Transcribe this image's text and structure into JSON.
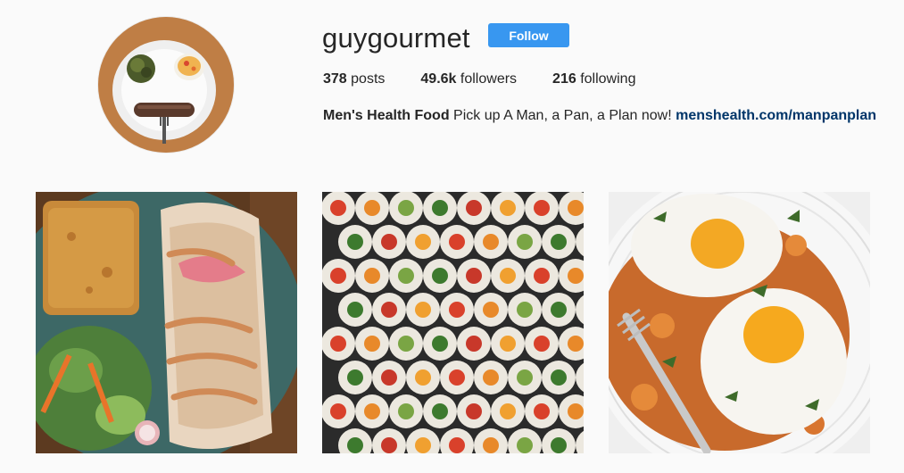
{
  "profile": {
    "username": "guygourmet",
    "follow_label": "Follow",
    "avatar_alt": "profile picture",
    "stats": {
      "posts_count": "378",
      "posts_label": "posts",
      "followers_count": "49.6k",
      "followers_label": "followers",
      "following_count": "216",
      "following_label": "following"
    },
    "bio": {
      "full_name": "Men's Health Food",
      "text": "Pick up A Man, a Pan, a Plan now!",
      "link": "menshealth.com/manpanplan"
    }
  },
  "posts": [
    {
      "subject": "burrito-cornbread-salad"
    },
    {
      "subject": "sushi-rolls-jalapeno"
    },
    {
      "subject": "fried-eggs-sweet-potato-hash"
    }
  ],
  "colors": {
    "background": "#fafafa",
    "text": "#262626",
    "follow_button": "#3897f0",
    "link": "#003569"
  }
}
